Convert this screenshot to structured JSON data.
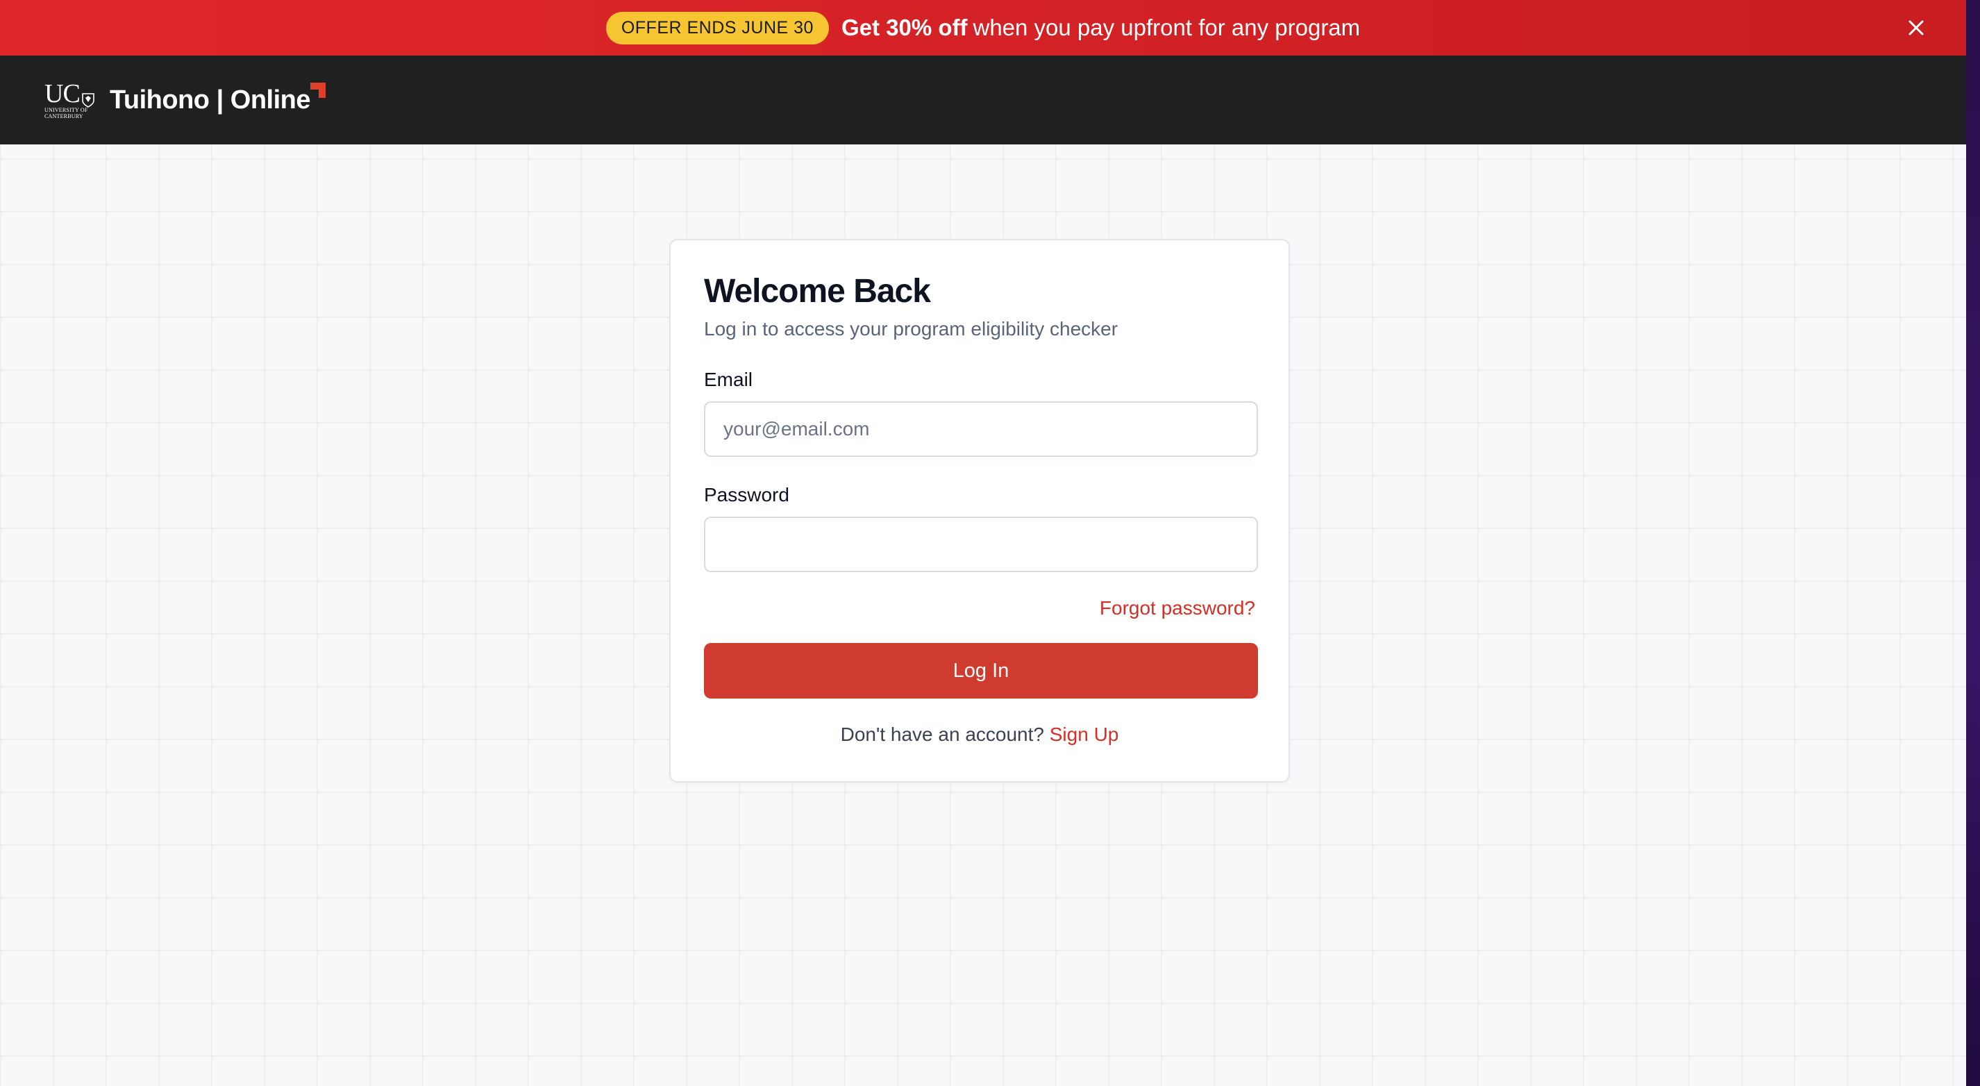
{
  "promo": {
    "badge": "OFFER ENDS JUNE 30",
    "headline_strong": "Get 30% off",
    "headline_rest": "when you pay upfront for any program",
    "close_icon": "close-icon"
  },
  "header": {
    "uc_letters": "UC",
    "uc_sub_line1": "UNIVERSITY OF",
    "uc_sub_line2": "CANTERBURY",
    "brand": "Tuihono | Online",
    "brand_mark_color": "#e0402a"
  },
  "login": {
    "title": "Welcome Back",
    "subtitle": "Log in to access your program eligibility checker",
    "email_label": "Email",
    "email_placeholder": "your@email.com",
    "email_value": "",
    "password_label": "Password",
    "password_value": "",
    "forgot_password": "Forgot password?",
    "submit_label": "Log In",
    "signup_prompt": "Don't have an account?",
    "signup_link": "Sign Up"
  },
  "colors": {
    "banner_red": "#d6232a",
    "badge_yellow": "#f7c531",
    "header_dark": "#202020",
    "accent_red": "#d03b2f",
    "link_red": "#d32f25"
  }
}
